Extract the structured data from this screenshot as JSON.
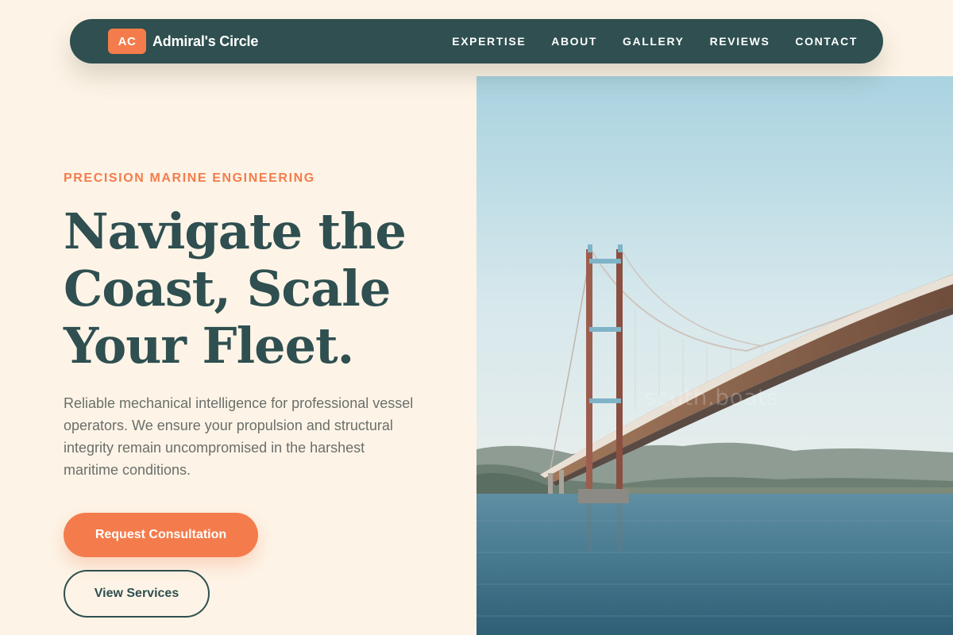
{
  "brand": {
    "badge": "AC",
    "name": "Admiral's Circle"
  },
  "nav": {
    "links": [
      {
        "label": "EXPERTISE"
      },
      {
        "label": "ABOUT"
      },
      {
        "label": "GALLERY"
      },
      {
        "label": "REVIEWS"
      },
      {
        "label": "CONTACT"
      }
    ]
  },
  "hero": {
    "eyebrow": "PRECISION MARINE ENGINEERING",
    "title_lines": [
      "Navigate the",
      "Coast, Scale",
      "Your Fleet."
    ],
    "description": "Reliable mechanical intelligence for professional vessel operators. We ensure your propulsion and structural integrity remain uncompromised in the harshest maritime conditions.",
    "primary_cta": "Request Consultation",
    "secondary_cta": "View Services",
    "image_watermark": "scuth.boats"
  },
  "colors": {
    "background": "#fdf4e7",
    "primary_dark": "#2f4f50",
    "accent": "#f47c4c",
    "body_text": "#6b6e6a"
  }
}
